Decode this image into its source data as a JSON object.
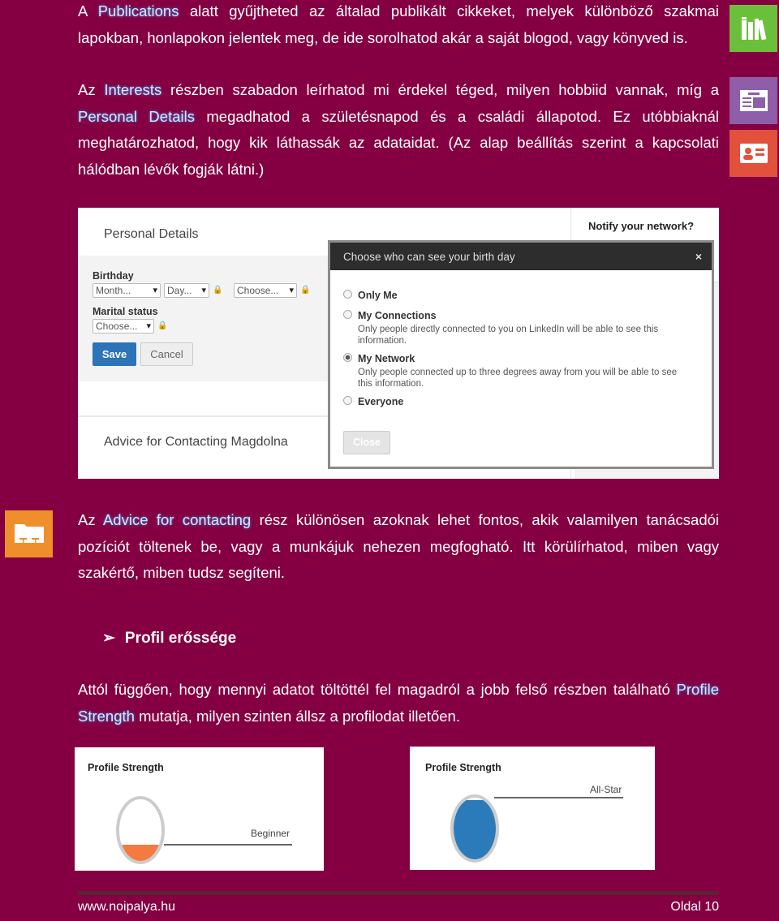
{
  "paragraphs": {
    "p1": {
      "before": "A ",
      "hl": "Publications",
      "after": " alatt gyűjtheted az általad publikált cikkeket, melyek különböző szakmai lapokban, honlapokon jelentek meg, de ide sorolhatod akár a saját blogod, vagy könyved is."
    },
    "p2": {
      "a": "Az ",
      "hl1": "Interests",
      "b": " részben szabadon leírhatod mi érdekel téged, milyen hobbiid vannak, míg a ",
      "hl2": "Personal Details",
      "c": " megadhatod a születésnapod és a családi állapotod. Ez utóbbiaknál meghatározhatod, hogy kik láthassák az adataidat. (Az alap beállítás szerint a kapcsolati hálódban lévők fogják látni.)"
    },
    "p3": {
      "a": "Az ",
      "hl": "Advice for contacting",
      "b": " rész különösen azoknak lehet fontos, akik valamilyen tanácsadói pozíciót töltenek be, vagy a munkájuk nehezen megfogható. Itt körülírhatod, miben vagy szakértő, miben tudsz segíteni."
    },
    "heading": "Profil erőssége",
    "p4": {
      "a": "Attól függően, hogy mennyi adatot töltöttél fel magadról a jobb felső részben található ",
      "hl": "Profile Strength",
      "b": " mutatja, milyen szinten állsz a profilodat illetően."
    }
  },
  "side_icons": [
    {
      "name": "books-icon",
      "color": "#6cbf3a"
    },
    {
      "name": "article-icon",
      "color": "#8e5ea8"
    },
    {
      "name": "id-card-icon",
      "color": "#e2513c"
    },
    {
      "name": "folder-icon",
      "color": "#ef8f2c"
    }
  ],
  "linkedin": {
    "section_title": "Personal Details",
    "birthday_label": "Birthday",
    "month": "Month...",
    "day": "Day...",
    "year_choose": "Choose...",
    "marital_label": "Marital status",
    "marital_choose": "Choose...",
    "save": "Save",
    "cancel": "Cancel",
    "advice_title": "Advice for Contacting Magdolna",
    "notify": "Notify your network?",
    "dialog": {
      "title": "Choose who can see your birth day",
      "close_x": "×",
      "options": [
        {
          "label": "Only Me",
          "desc": "",
          "selected": false
        },
        {
          "label": "My Connections",
          "desc": "Only people directly connected to you on LinkedIn will be able to see this information.",
          "selected": false
        },
        {
          "label": "My Network",
          "desc": "Only people connected up to three degrees away from you will be able to see this information.",
          "selected": true
        },
        {
          "label": "Everyone",
          "desc": "",
          "selected": false
        }
      ],
      "close_button": "Close"
    }
  },
  "strength": [
    {
      "title": "Profile Strength",
      "level": "Beginner",
      "fill_color": "#f47a40",
      "fill_fraction": 0.25
    },
    {
      "title": "Profile Strength",
      "level": "All-Star",
      "fill_color": "#2b7bba",
      "fill_fraction": 0.95
    }
  ],
  "footer": {
    "site": "www.noipalya.hu",
    "page": "Oldal 10"
  }
}
